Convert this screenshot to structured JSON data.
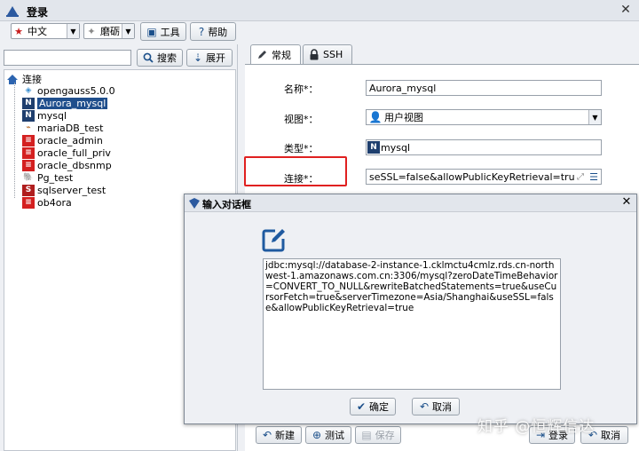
{
  "window": {
    "title": "登录",
    "close_glyph": "✕"
  },
  "toolbar": {
    "language": {
      "value": "中文",
      "icon": "flag-icon"
    },
    "theme": {
      "value": "磨砺",
      "icon": "theme-icon"
    },
    "tools_label": "工具",
    "help_label": "帮助"
  },
  "left": {
    "search": {
      "value": "",
      "placeholder": ""
    },
    "search_button": "搜索",
    "expand_button": "展开",
    "tree": {
      "root": "连接",
      "items": [
        {
          "label": "opengauss5.0.0",
          "icon": "opengauss-icon"
        },
        {
          "label": "Aurora_mysql",
          "icon": "mysql-icon",
          "selected": true
        },
        {
          "label": "mysql",
          "icon": "mysql-icon"
        },
        {
          "label": "mariaDB_test",
          "icon": "mariadb-icon"
        },
        {
          "label": "oracle_admin",
          "icon": "oracle-icon"
        },
        {
          "label": "oracle_full_priv",
          "icon": "oracle-icon"
        },
        {
          "label": "oracle_dbsnmp",
          "icon": "oracle-icon"
        },
        {
          "label": "Pg_test",
          "icon": "postgres-icon"
        },
        {
          "label": "sqlserver_test",
          "icon": "sqlserver-icon"
        },
        {
          "label": "ob4ora",
          "icon": "oracle-icon"
        }
      ]
    }
  },
  "tabs": [
    {
      "label": "常规",
      "active": true
    },
    {
      "label": "SSH",
      "active": false
    }
  ],
  "form": {
    "name": {
      "label": "名称*：",
      "value": "Aurora_mysql"
    },
    "view": {
      "label": "视图*：",
      "value": "用户视图"
    },
    "type": {
      "label": "类型*：",
      "value": "mysql"
    },
    "connection": {
      "label": "连接*：",
      "value": "seSSL=false&allowPublicKeyRetrieval=true"
    }
  },
  "bottom": {
    "new_label": "新建",
    "test_label": "测试",
    "save_label": "保存",
    "login_label": "登录",
    "cancel_label": "取消"
  },
  "dialog": {
    "title": "输入对话框",
    "url": "jdbc:mysql://database-2-instance-1.cklmctu4cmlz.rds.cn-northwest-1.amazonaws.com.cn:3306/mysql?zeroDateTimeBehavior=CONVERT_TO_NULL&rewriteBatchedStatements=true&useCursorFetch=true&serverTimezone=Asia/Shanghai&useSSL=false&allowPublicKeyRetrieval=true",
    "ok_label": "确定",
    "cancel_label": "取消"
  },
  "watermark": "知乎 @恒辉信达",
  "colors": {
    "selection": "#1f4e8c",
    "highlight_box": "#e02020",
    "button_icon": "#1b4f8a"
  }
}
